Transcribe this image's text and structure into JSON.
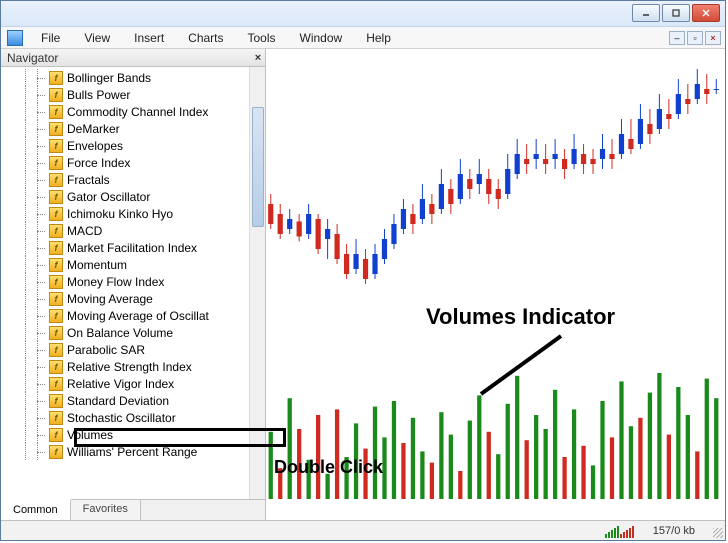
{
  "menu": [
    "File",
    "View",
    "Insert",
    "Charts",
    "Tools",
    "Window",
    "Help"
  ],
  "navigator": {
    "title": "Navigator",
    "tabs": {
      "common": "Common",
      "favorites": "Favorites"
    },
    "indicators": [
      "Bollinger Bands",
      "Bulls Power",
      "Commodity Channel Index",
      "DeMarker",
      "Envelopes",
      "Force Index",
      "Fractals",
      "Gator Oscillator",
      "Ichimoku Kinko Hyo",
      "MACD",
      "Market Facilitation Index",
      "Momentum",
      "Money Flow Index",
      "Moving Average",
      "Moving Average of Oscillat",
      "On Balance Volume",
      "Parabolic SAR",
      "Relative Strength Index",
      "Relative Vigor Index",
      "Standard Deviation",
      "Stochastic Oscillator",
      "Volumes",
      "Williams' Percent Range"
    ],
    "highlighted_index": 21
  },
  "annotations": {
    "volumes_label": "Volumes Indicator",
    "double_click": "Double Click"
  },
  "status": {
    "transfer": "157/0 kb"
  },
  "colors": {
    "bull": "#1a8a1a",
    "bear": "#d02a20",
    "candle_blue": "#1040d0"
  },
  "chart_data": {
    "type": "candlestick+volume",
    "note": "values estimated from pixel positions; relative price levels (0=low area, 100=high area)",
    "candles_open_close_low_high_dir": [
      [
        42,
        34,
        32,
        46,
        "bear"
      ],
      [
        38,
        30,
        28,
        42,
        "bear"
      ],
      [
        32,
        36,
        30,
        40,
        "bull"
      ],
      [
        35,
        29,
        27,
        38,
        "bear"
      ],
      [
        30,
        38,
        28,
        42,
        "bull"
      ],
      [
        36,
        24,
        22,
        38,
        "bear"
      ],
      [
        28,
        32,
        20,
        36,
        "bull"
      ],
      [
        30,
        20,
        18,
        34,
        "bear"
      ],
      [
        22,
        14,
        12,
        26,
        "bear"
      ],
      [
        16,
        22,
        14,
        28,
        "bull"
      ],
      [
        20,
        12,
        10,
        24,
        "bear"
      ],
      [
        14,
        22,
        12,
        26,
        "bull"
      ],
      [
        20,
        28,
        18,
        32,
        "bull"
      ],
      [
        26,
        34,
        24,
        38,
        "bull"
      ],
      [
        32,
        40,
        30,
        44,
        "bull"
      ],
      [
        38,
        34,
        30,
        42,
        "bear"
      ],
      [
        36,
        44,
        34,
        50,
        "bull"
      ],
      [
        42,
        38,
        34,
        46,
        "bear"
      ],
      [
        40,
        50,
        38,
        56,
        "bull"
      ],
      [
        48,
        42,
        38,
        52,
        "bear"
      ],
      [
        44,
        54,
        42,
        60,
        "bull"
      ],
      [
        52,
        48,
        44,
        56,
        "bear"
      ],
      [
        50,
        54,
        46,
        60,
        "bull"
      ],
      [
        52,
        46,
        42,
        56,
        "bear"
      ],
      [
        48,
        44,
        40,
        52,
        "bear"
      ],
      [
        46,
        56,
        44,
        62,
        "bull"
      ],
      [
        54,
        62,
        52,
        68,
        "bull"
      ],
      [
        60,
        58,
        54,
        66,
        "bear"
      ],
      [
        60,
        62,
        56,
        68,
        "bull"
      ],
      [
        60,
        58,
        54,
        66,
        "bear"
      ],
      [
        60,
        62,
        56,
        68,
        "bull"
      ],
      [
        60,
        56,
        52,
        64,
        "bear"
      ],
      [
        58,
        64,
        56,
        70,
        "bull"
      ],
      [
        62,
        58,
        54,
        66,
        "bear"
      ],
      [
        60,
        58,
        54,
        64,
        "bear"
      ],
      [
        60,
        64,
        56,
        70,
        "bull"
      ],
      [
        62,
        60,
        56,
        68,
        "bear"
      ],
      [
        62,
        70,
        60,
        76,
        "bull"
      ],
      [
        68,
        64,
        62,
        76,
        "bear"
      ],
      [
        66,
        76,
        64,
        82,
        "bull"
      ],
      [
        74,
        70,
        66,
        80,
        "bear"
      ],
      [
        72,
        80,
        70,
        86,
        "bull"
      ],
      [
        78,
        76,
        72,
        84,
        "bear"
      ],
      [
        78,
        86,
        76,
        92,
        "bull"
      ],
      [
        84,
        82,
        78,
        90,
        "bear"
      ],
      [
        84,
        90,
        82,
        96,
        "bull"
      ],
      [
        88,
        86,
        82,
        94,
        "bear"
      ],
      [
        88,
        88,
        86,
        92,
        "bull"
      ]
    ],
    "volumes": [
      [
        48,
        "g"
      ],
      [
        22,
        "r"
      ],
      [
        72,
        "g"
      ],
      [
        50,
        "r"
      ],
      [
        28,
        "g"
      ],
      [
        60,
        "r"
      ],
      [
        18,
        "g"
      ],
      [
        64,
        "r"
      ],
      [
        30,
        "g"
      ],
      [
        54,
        "g"
      ],
      [
        36,
        "r"
      ],
      [
        66,
        "g"
      ],
      [
        44,
        "g"
      ],
      [
        70,
        "g"
      ],
      [
        40,
        "r"
      ],
      [
        58,
        "g"
      ],
      [
        34,
        "g"
      ],
      [
        26,
        "r"
      ],
      [
        62,
        "g"
      ],
      [
        46,
        "g"
      ],
      [
        20,
        "r"
      ],
      [
        56,
        "g"
      ],
      [
        74,
        "g"
      ],
      [
        48,
        "r"
      ],
      [
        32,
        "g"
      ],
      [
        68,
        "g"
      ],
      [
        88,
        "g"
      ],
      [
        42,
        "r"
      ],
      [
        60,
        "g"
      ],
      [
        50,
        "g"
      ],
      [
        78,
        "g"
      ],
      [
        30,
        "r"
      ],
      [
        64,
        "g"
      ],
      [
        38,
        "r"
      ],
      [
        24,
        "g"
      ],
      [
        70,
        "g"
      ],
      [
        44,
        "r"
      ],
      [
        84,
        "g"
      ],
      [
        52,
        "g"
      ],
      [
        58,
        "r"
      ],
      [
        76,
        "g"
      ],
      [
        90,
        "g"
      ],
      [
        46,
        "r"
      ],
      [
        80,
        "g"
      ],
      [
        60,
        "g"
      ],
      [
        34,
        "r"
      ],
      [
        86,
        "g"
      ],
      [
        72,
        "g"
      ]
    ]
  }
}
